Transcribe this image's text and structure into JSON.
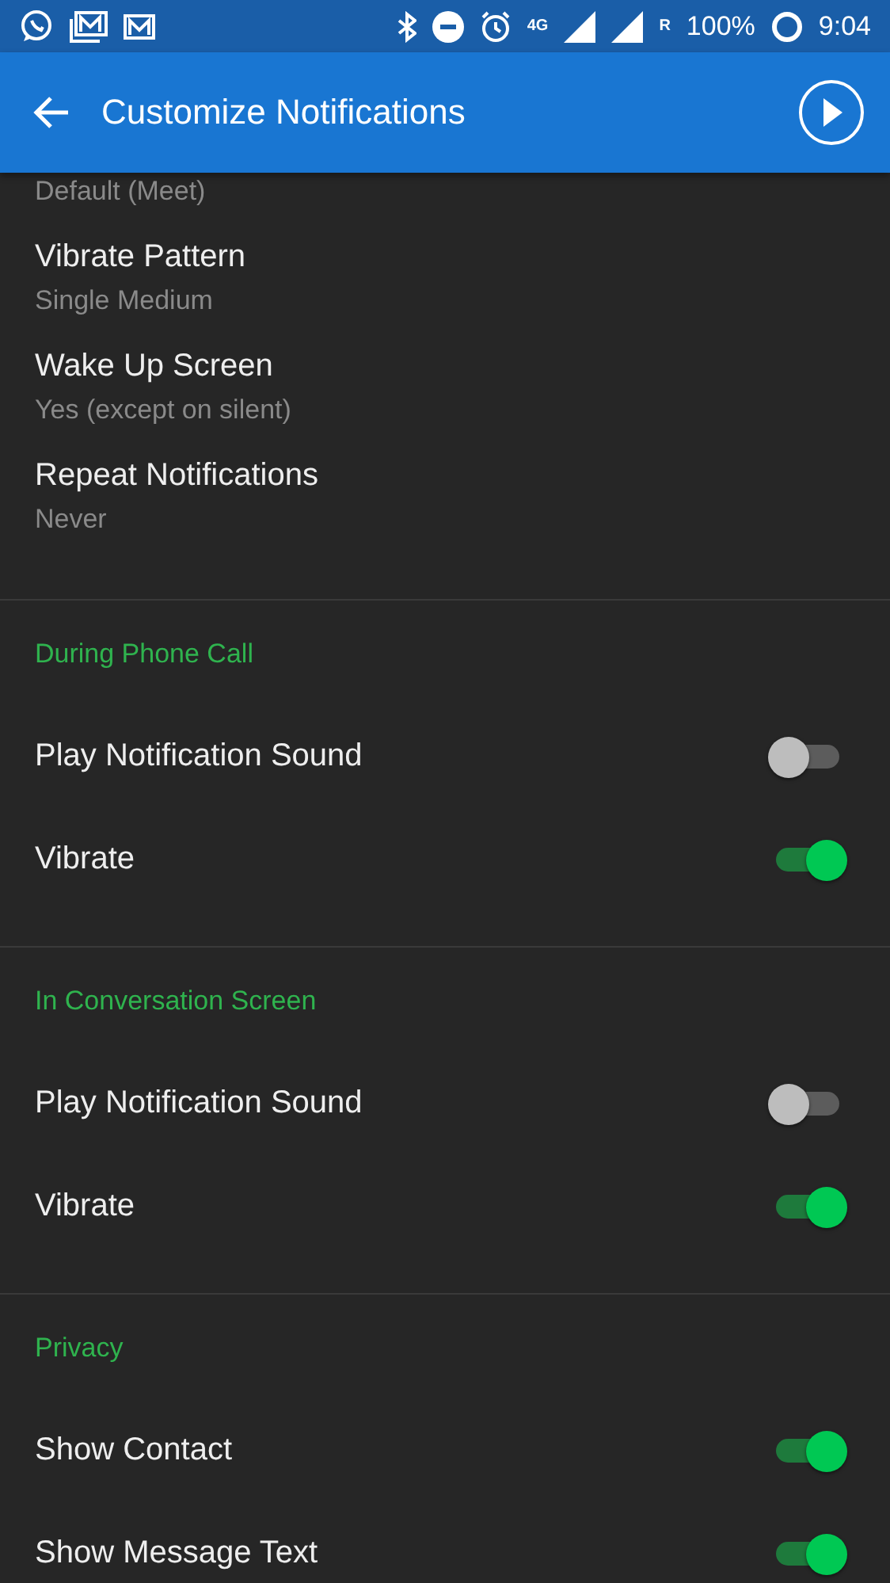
{
  "status_bar": {
    "network": "4G",
    "roaming": "R",
    "battery": "100%",
    "time": "9:04"
  },
  "app_bar": {
    "title": "Customize Notifications"
  },
  "preferences": [
    {
      "value": "Default (Meet)"
    },
    {
      "title": "Vibrate Pattern",
      "value": "Single Medium"
    },
    {
      "title": "Wake Up Screen",
      "value": "Yes (except on silent)"
    },
    {
      "title": "Repeat Notifications",
      "value": "Never"
    }
  ],
  "sections": [
    {
      "header": "During Phone Call",
      "toggles": [
        {
          "label": "Play Notification Sound",
          "on": false
        },
        {
          "label": "Vibrate",
          "on": true
        }
      ]
    },
    {
      "header": "In Conversation Screen",
      "toggles": [
        {
          "label": "Play Notification Sound",
          "on": false
        },
        {
          "label": "Vibrate",
          "on": true
        }
      ]
    },
    {
      "header": "Privacy",
      "toggles": [
        {
          "label": "Show Contact",
          "on": true
        },
        {
          "label": "Show Message Text",
          "on": true
        }
      ]
    }
  ]
}
